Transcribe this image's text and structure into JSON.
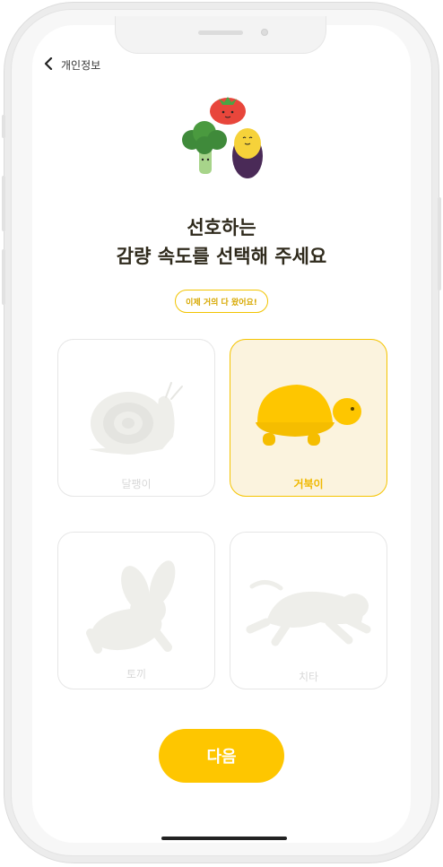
{
  "header": {
    "back_label": "개인정보"
  },
  "title": {
    "line1": "선호하는",
    "line2": "감량 속도를 선택해 주세요"
  },
  "badge": {
    "text": "이제 거의 다 왔어요!"
  },
  "options": [
    {
      "label": "달팽이",
      "icon": "snail-icon",
      "selected": false
    },
    {
      "label": "거북이",
      "icon": "turtle-icon",
      "selected": true
    },
    {
      "label": "토끼",
      "icon": "rabbit-icon",
      "selected": false
    },
    {
      "label": "치타",
      "icon": "cheetah-icon",
      "selected": false
    }
  ],
  "next_button": {
    "label": "다음"
  },
  "colors": {
    "accent": "#fec600",
    "selected_bg": "#fbf3de",
    "muted": "#e6e6e6"
  }
}
